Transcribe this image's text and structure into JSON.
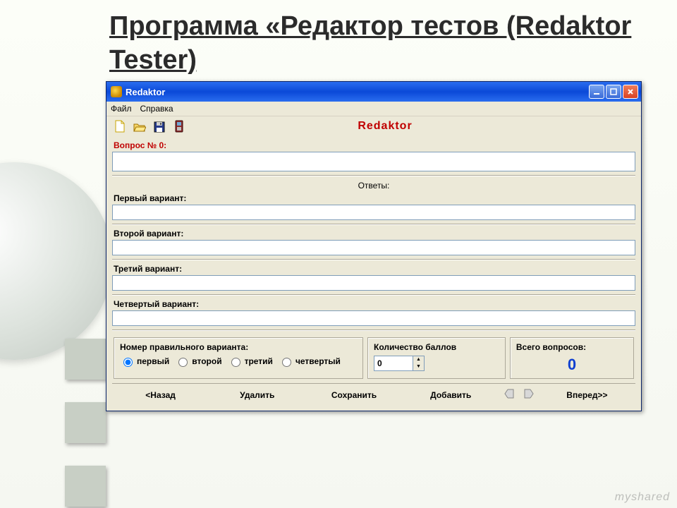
{
  "slide": {
    "title": "Программа «Редактор тестов (Redaktor Tester)"
  },
  "window": {
    "title": "Redaktor",
    "menu": {
      "file": "Файл",
      "help": "Справка"
    },
    "brand": "Redaktor",
    "question_label": "Вопрос № 0:",
    "question_value": "",
    "answers_label": "Ответы:",
    "variants": [
      {
        "label": "Первый вариант:",
        "value": ""
      },
      {
        "label": "Второй вариант:",
        "value": ""
      },
      {
        "label": "Третий вариант:",
        "value": ""
      },
      {
        "label": "Четвертый вариант:",
        "value": ""
      }
    ],
    "correct_group": {
      "title": "Номер правильного варианта:",
      "options": [
        "первый",
        "второй",
        "третий",
        "четвертый"
      ],
      "selected": 0
    },
    "points": {
      "title": "Количество баллов",
      "value": "0"
    },
    "total": {
      "title": "Всего вопросов:",
      "value": "0"
    },
    "nav": {
      "back": "<Назад",
      "delete": "Удалить",
      "save": "Сохранить",
      "add": "Добавить",
      "forward": "Вперед>>"
    }
  },
  "watermark": "myshared"
}
